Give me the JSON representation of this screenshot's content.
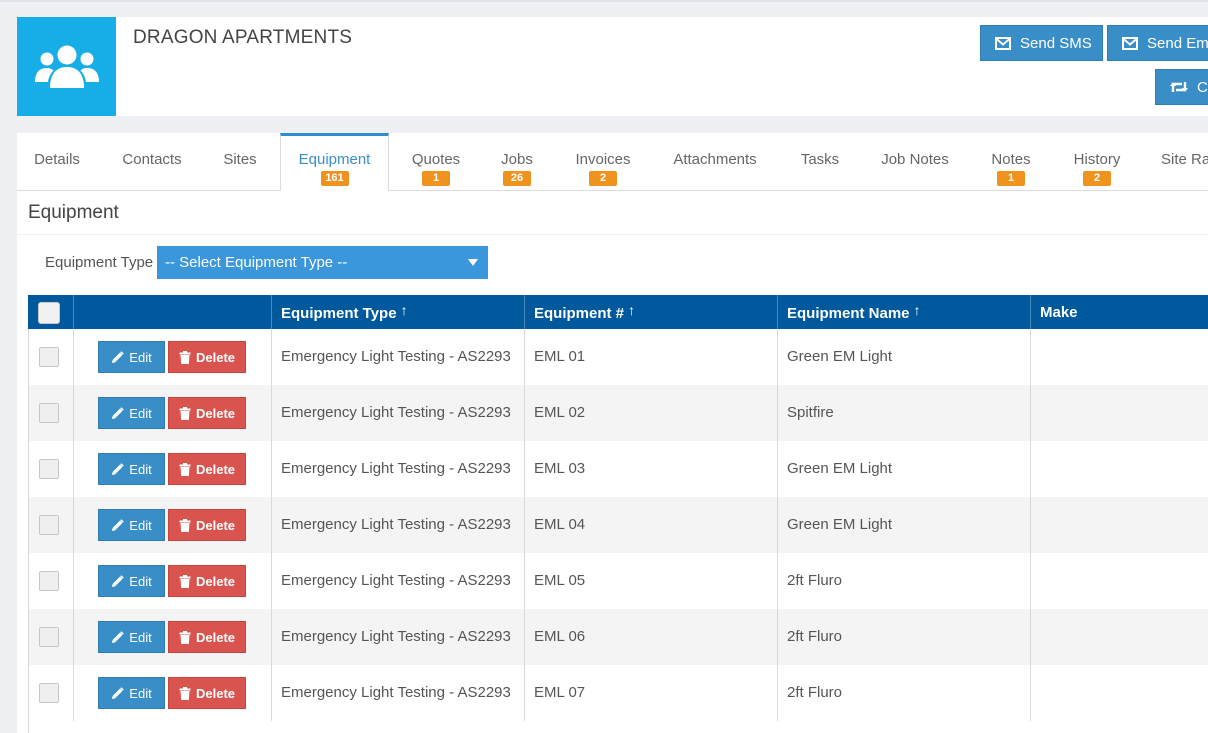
{
  "header": {
    "company_name": "DRAGON APARTMENTS",
    "avatar_icon": "users-icon",
    "buttons": {
      "send_sms": "Send SMS",
      "send_email": "Send Ema",
      "third": "Cr"
    }
  },
  "tabs": [
    {
      "label": "Details",
      "badge": ""
    },
    {
      "label": "Contacts",
      "badge": ""
    },
    {
      "label": "Sites",
      "badge": ""
    },
    {
      "label": "Equipment",
      "badge": "161"
    },
    {
      "label": "Quotes",
      "badge": "1"
    },
    {
      "label": "Jobs",
      "badge": "26"
    },
    {
      "label": "Invoices",
      "badge": "2"
    },
    {
      "label": "Attachments",
      "badge": ""
    },
    {
      "label": "Tasks",
      "badge": ""
    },
    {
      "label": "Job Notes",
      "badge": ""
    },
    {
      "label": "Notes",
      "badge": "1"
    },
    {
      "label": "History",
      "badge": "2"
    },
    {
      "label": "Site Ra",
      "badge": ""
    }
  ],
  "panel": {
    "title": "Equipment",
    "filter_label": "Equipment Type",
    "filter_value": "-- Select Equipment Type --"
  },
  "table": {
    "columns": {
      "equipment_type": "Equipment Type",
      "equipment_number": "Equipment #",
      "equipment_name": "Equipment Name",
      "make": "Make"
    },
    "edit_label": "Edit",
    "delete_label": "Delete",
    "rows": [
      {
        "type": "Emergency Light Testing - AS2293",
        "number": "EML 01",
        "name": "Green EM Light",
        "make": ""
      },
      {
        "type": "Emergency Light Testing - AS2293",
        "number": "EML 02",
        "name": "Spitfire",
        "make": ""
      },
      {
        "type": "Emergency Light Testing - AS2293",
        "number": "EML 03",
        "name": "Green EM Light",
        "make": ""
      },
      {
        "type": "Emergency Light Testing - AS2293",
        "number": "EML 04",
        "name": "Green EM Light",
        "make": ""
      },
      {
        "type": "Emergency Light Testing - AS2293",
        "number": "EML 05",
        "name": "2ft Fluro",
        "make": ""
      },
      {
        "type": "Emergency Light Testing - AS2293",
        "number": "EML 06",
        "name": "2ft Fluro",
        "make": ""
      },
      {
        "type": "Emergency Light Testing - AS2293",
        "number": "EML 07",
        "name": "2ft Fluro",
        "make": ""
      }
    ]
  },
  "colors": {
    "accent_blue": "#3a8ec8",
    "header_navy": "#00599d",
    "badge_orange": "#f0931e",
    "danger_red": "#d9534f",
    "avatar_cyan": "#17aee8"
  }
}
